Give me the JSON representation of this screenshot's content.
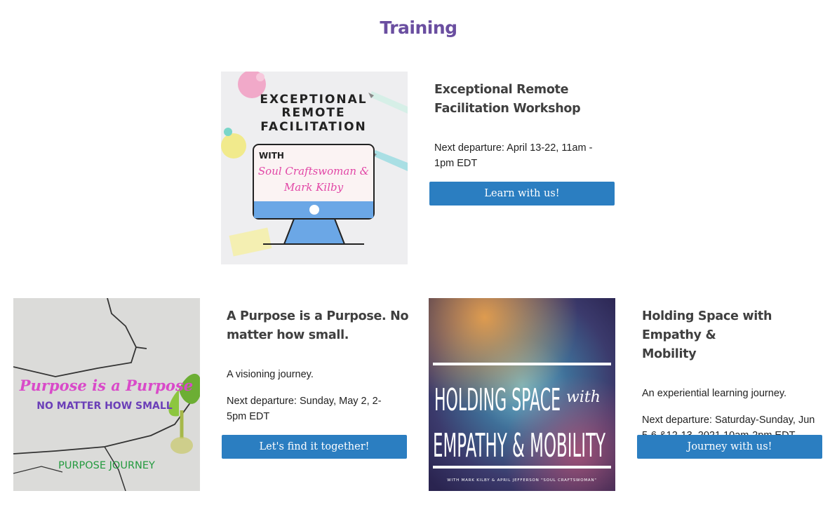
{
  "page": {
    "title": "Training"
  },
  "colors": {
    "title": "#6a4ea0",
    "button": "#2b7ec1"
  },
  "cards": [
    {
      "image_text": {
        "line1": "EXCEPTIONAL",
        "line2": "REMOTE",
        "line3": "FACILITATION",
        "with": "WITH",
        "script1": "Soul Craftswoman &",
        "script2": "Mark Kilby"
      },
      "title_line1": "Exceptional Remote",
      "title_line2": "Facilitation Workshop",
      "departure_line1": "Next departure: April 13-22, 11am -",
      "departure_line2": "1pm EDT",
      "button": "Learn with us!"
    },
    {
      "image_text": {
        "script": "a Purpose is a Purpose",
        "caps": "NO MATTER HOW SMALL",
        "footer": "PURPOSE JOURNEY"
      },
      "title_line1": "A Purpose is a Purpose. No",
      "title_line2": "matter how small.",
      "description": "A visioning journey.",
      "departure_line1": "Next departure: Sunday, May 2, 2-",
      "departure_line2": "5pm EDT",
      "button": "Let's find it together!"
    },
    {
      "image_text": {
        "line1": "HOLDING SPACE",
        "with": "with",
        "line2": "EMPATHY & MOBILITY",
        "credit": "WITH MARK KILBY & APRIL JEFFERSON \"SOUL CRAFTSWOMAN\""
      },
      "title_line1": "Holding Space with Empathy &",
      "title_line2": "Mobility",
      "description": "An experiential learning journey.",
      "departure_line1": "Next departure: Saturday-Sunday, Jun",
      "departure_line2": "5-6 &12-13, 2021 10am-2pm EDT",
      "button": "Journey with us!"
    }
  ]
}
